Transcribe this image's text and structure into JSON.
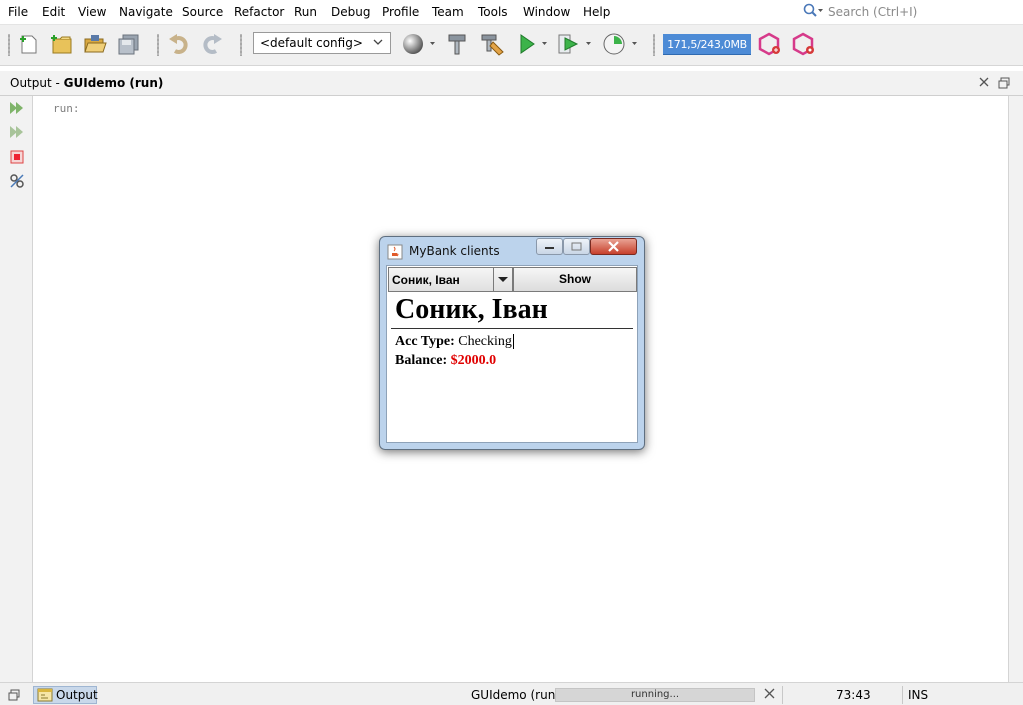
{
  "menu": [
    "File",
    "Edit",
    "View",
    "Navigate",
    "Source",
    "Refactor",
    "Run",
    "Debug",
    "Profile",
    "Team",
    "Tools",
    "Window",
    "Help"
  ],
  "search": {
    "placeholder": "Search (Ctrl+I)",
    "icon": "magnifier-icon"
  },
  "toolbar": {
    "config": "<default config>",
    "memory": "171,5/243,0MB"
  },
  "output": {
    "title_prefix": "Output - ",
    "title_bold": "GUIdemo (run)",
    "text": "run:"
  },
  "dialog": {
    "title": "MyBank clients",
    "combo_value": "Соник, Іван",
    "show_label": "Show",
    "client_name": "Соник, Іван",
    "acc_type_label": "Acc Type:",
    "acc_type_value": "Checking",
    "balance_label": "Balance:",
    "balance_value": "$2000.0"
  },
  "status": {
    "tab_label": "Output",
    "process": "GUIdemo (run)",
    "progress_text": "running...",
    "position": "73:43",
    "mode": "INS"
  },
  "colors": {
    "memory_bar": "#4d8bd6",
    "balance": "#e00000",
    "dialog_frame": "#bcd3ec"
  }
}
